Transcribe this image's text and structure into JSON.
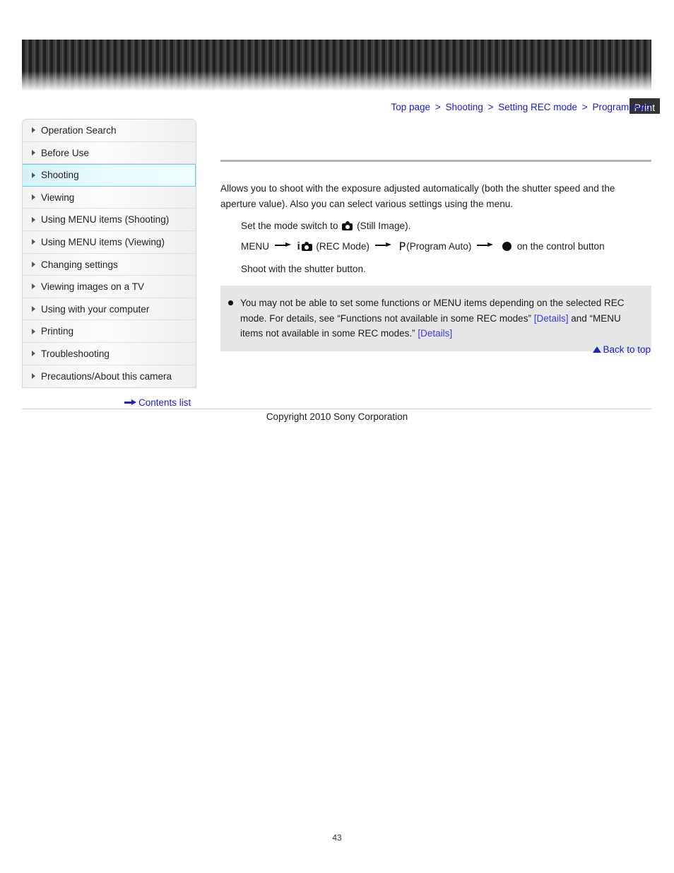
{
  "header": {
    "print_label": "Print"
  },
  "breadcrumb": {
    "items": [
      "Top page",
      "Shooting",
      "Setting REC mode",
      "Program Auto"
    ],
    "separator": ">"
  },
  "sidebar": {
    "items": [
      {
        "label": "Operation Search",
        "active": false
      },
      {
        "label": "Before Use",
        "active": false
      },
      {
        "label": "Shooting",
        "active": true
      },
      {
        "label": "Viewing",
        "active": false
      },
      {
        "label": "Using MENU items (Shooting)",
        "active": false
      },
      {
        "label": "Using MENU items (Viewing)",
        "active": false
      },
      {
        "label": "Changing settings",
        "active": false
      },
      {
        "label": "Viewing images on a TV",
        "active": false
      },
      {
        "label": "Using with your computer",
        "active": false
      },
      {
        "label": "Printing",
        "active": false
      },
      {
        "label": "Troubleshooting",
        "active": false
      },
      {
        "label": "Precautions/About this camera",
        "active": false
      }
    ],
    "contents_list_label": "Contents list"
  },
  "content": {
    "intro": "Allows you to shoot with the exposure adjusted automatically (both the shutter speed and the aperture value). Also you can select various settings using the menu.",
    "step1_before": "Set the mode switch to",
    "step1_after": "(Still Image).",
    "step2_menu": "MENU",
    "step2_rec_mode": "(REC Mode)",
    "step2_program_auto": "(Program Auto)",
    "step2_control": "on the control button",
    "step2_i_glyph": "i",
    "step2_p_glyph": "P",
    "step3": "Shoot with the shutter button."
  },
  "note": {
    "text_part1": "You may not be able to set some functions or MENU items depending on the selected REC mode. For details, see “Functions not available in some REC modes” ",
    "details_1": "[Details]",
    "text_part2": " and “MENU items not available in some REC modes.” ",
    "details_2": "[Details]"
  },
  "back_to_top": {
    "label": "Back to top"
  },
  "footer": {
    "copyright": "Copyright 2010 Sony Corporation",
    "page_number": "43"
  },
  "colors": {
    "link_blue": "#1a1ad0",
    "details_blue": "#3a3ae0",
    "active_cyan": "#5fd3ef",
    "note_bg": "#e6e6e6",
    "rule_gray": "#b3b3b3"
  }
}
